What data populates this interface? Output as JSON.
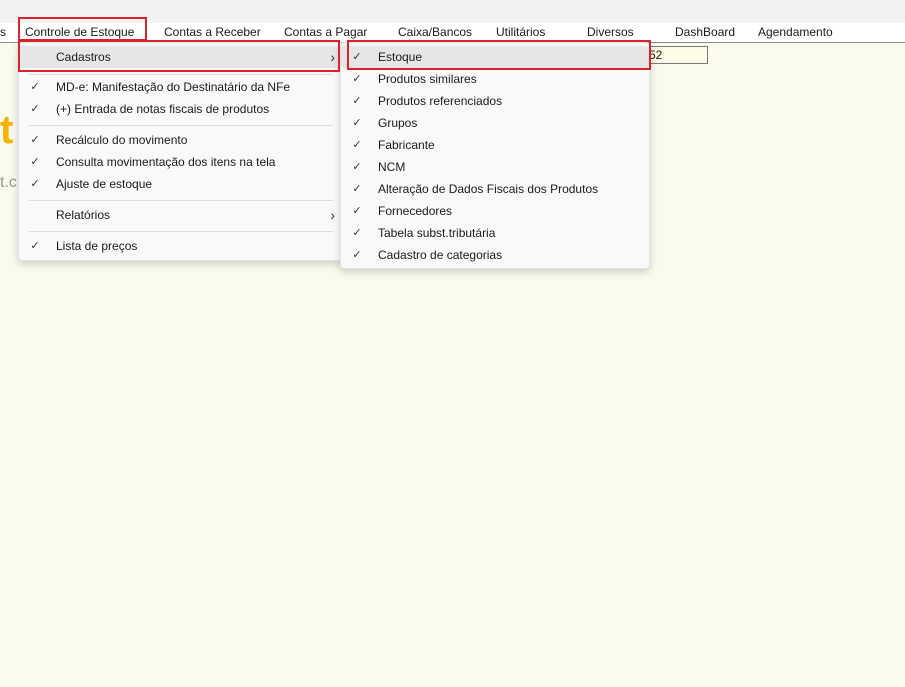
{
  "menubar": {
    "items": [
      {
        "label": "s"
      },
      {
        "label": "Controle de Estoque"
      },
      {
        "label": "Contas a Receber"
      },
      {
        "label": "Contas a Pagar"
      },
      {
        "label": "Caixa/Bancos"
      },
      {
        "label": "Utilitários"
      },
      {
        "label": "Diversos"
      },
      {
        "label": "DashBoard"
      },
      {
        "label": "Agendamento"
      }
    ]
  },
  "field": {
    "value": "52"
  },
  "background": {
    "logo_fragment": "t",
    "logo_sub_fragment": "t.c"
  },
  "estoque_menu": {
    "items": [
      {
        "label": "Cadastros",
        "arrow": "›"
      },
      {
        "label": "MD-e: Manifestação do Destinatário da NFe",
        "check": "✓"
      },
      {
        "label": "(+) Entrada de notas fiscais de produtos",
        "check": "✓"
      },
      {
        "label": "Recálculo do movimento",
        "check": "✓"
      },
      {
        "label": "Consulta movimentação dos itens na tela",
        "check": "✓"
      },
      {
        "label": "Ajuste de estoque",
        "check": "✓"
      },
      {
        "label": "Relatórios",
        "arrow": "›"
      },
      {
        "label": "Lista de preços",
        "check": "✓"
      }
    ]
  },
  "cadastros_menu": {
    "items": [
      {
        "label": "Estoque",
        "check": "✓"
      },
      {
        "label": "Produtos similares",
        "check": "✓"
      },
      {
        "label": "Produtos referenciados",
        "check": "✓"
      },
      {
        "label": "Grupos",
        "check": "✓"
      },
      {
        "label": "Fabricante",
        "check": "✓"
      },
      {
        "label": "NCM",
        "check": "✓"
      },
      {
        "label": "Alteração de Dados Fiscais dos Produtos",
        "check": "✓"
      },
      {
        "label": "Fornecedores",
        "check": "✓"
      },
      {
        "label": "Tabela subst.tributária",
        "check": "✓"
      },
      {
        "label": "Cadastro de categorias",
        "check": "✓"
      }
    ]
  },
  "colors": {
    "highlight_box": "#d9232d",
    "background": "#fafaed",
    "logo": "#f2b400"
  }
}
